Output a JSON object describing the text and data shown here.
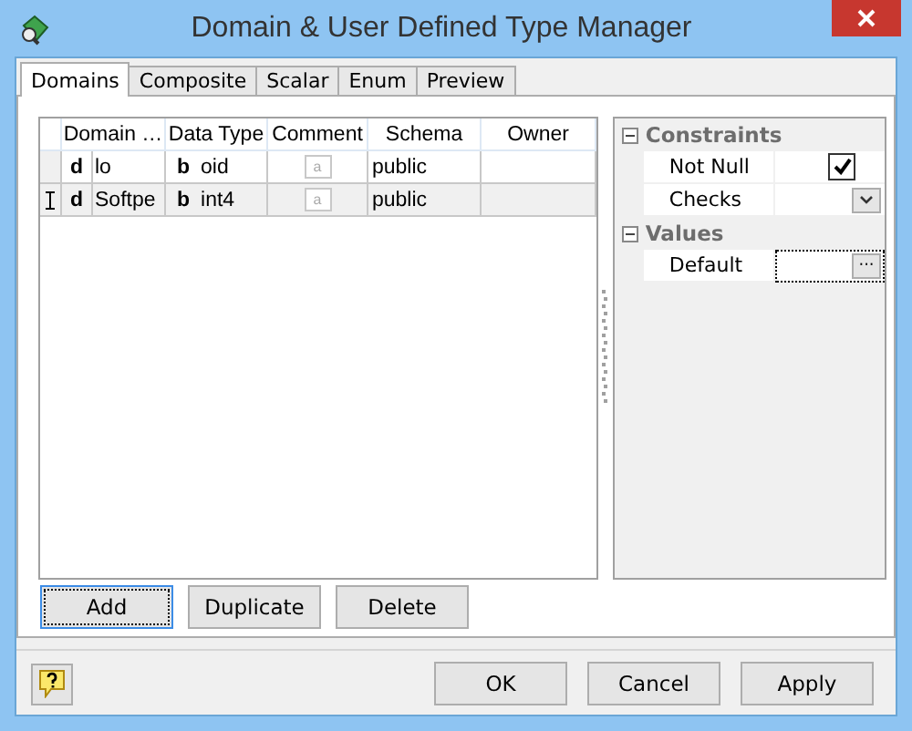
{
  "window": {
    "title": "Domain & User Defined Type Manager"
  },
  "tabs": [
    {
      "label": "Domains",
      "selected": true
    },
    {
      "label": "Composite",
      "selected": false
    },
    {
      "label": "Scalar",
      "selected": false
    },
    {
      "label": "Enum",
      "selected": false
    },
    {
      "label": "Preview",
      "selected": false
    }
  ],
  "grid": {
    "columns": [
      "Domain …",
      "Data Type",
      "Comment",
      "Schema",
      "Owner"
    ],
    "rows": [
      {
        "selected": false,
        "editing": false,
        "domain_mark": "d",
        "domain": "lo",
        "type_mark": "b",
        "data_type": "oid",
        "comment_mark": "a",
        "schema": "public",
        "owner": ""
      },
      {
        "selected": true,
        "editing": true,
        "domain_mark": "d",
        "domain": "Softpe",
        "type_mark": "b",
        "data_type": "int4",
        "comment_mark": "a",
        "schema": "public",
        "owner": ""
      }
    ]
  },
  "properties": [
    {
      "category": "Constraints",
      "expanded": true,
      "items": [
        {
          "kind": "checkbox",
          "label": "Not Null",
          "checked": true
        },
        {
          "kind": "dropdown",
          "label": "Checks"
        }
      ]
    },
    {
      "category": "Values",
      "expanded": true,
      "items": [
        {
          "kind": "ellipsis",
          "label": "Default",
          "button": "···",
          "focused": true
        }
      ]
    }
  ],
  "grid_buttons": [
    {
      "label": "Add",
      "focused": true
    },
    {
      "label": "Duplicate",
      "focused": false
    },
    {
      "label": "Delete",
      "focused": false
    }
  ],
  "dialog_buttons": [
    "OK",
    "Cancel",
    "Apply"
  ]
}
